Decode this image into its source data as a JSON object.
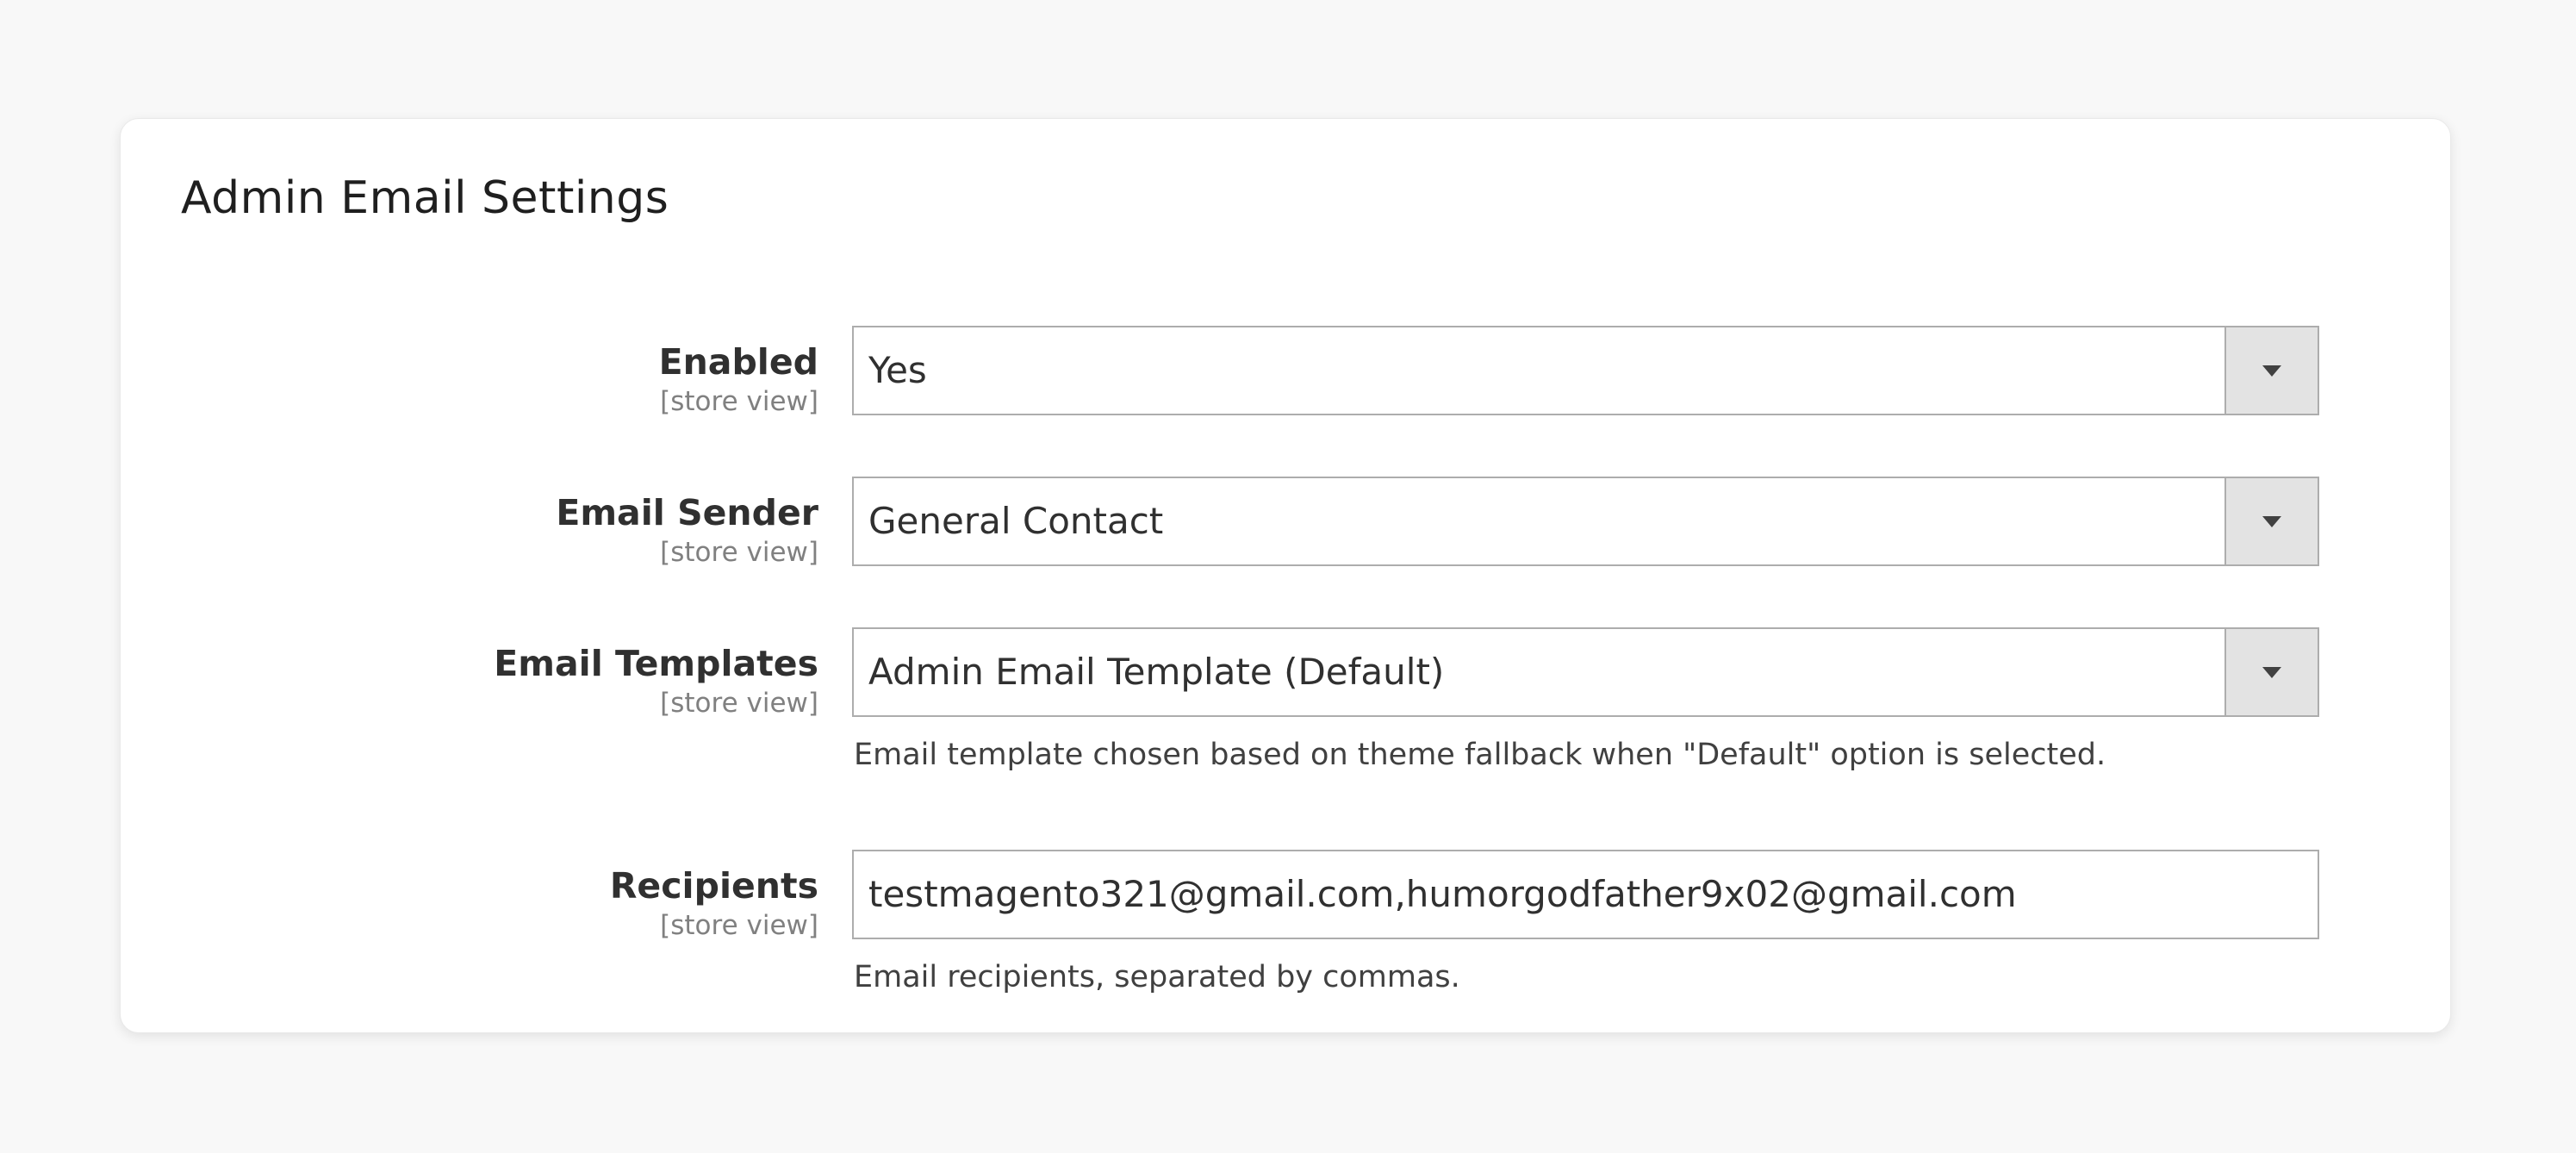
{
  "section": {
    "title": "Admin Email Settings"
  },
  "fields": {
    "enabled": {
      "label": "Enabled",
      "scope": "[store view]",
      "value": "Yes"
    },
    "email_sender": {
      "label": "Email Sender",
      "scope": "[store view]",
      "value": "General Contact"
    },
    "email_templates": {
      "label": "Email Templates",
      "scope": "[store view]",
      "value": "Admin Email Template (Default)",
      "note": "Email template chosen based on theme fallback when \"Default\" option is selected."
    },
    "recipients": {
      "label": "Recipients",
      "scope": "[store view]",
      "value": "testmagento321@gmail.com,humorgodfather9x02@gmail.com",
      "note": "Email recipients, separated by commas."
    }
  },
  "icons": {
    "select_toggle": "chevron-down-icon"
  },
  "colors": {
    "background": "#f8f8f8",
    "card": "#ffffff",
    "field_border": "#adadad",
    "select_button": "#e3e3e3",
    "label_text": "#303030",
    "scope_text": "#808080"
  }
}
